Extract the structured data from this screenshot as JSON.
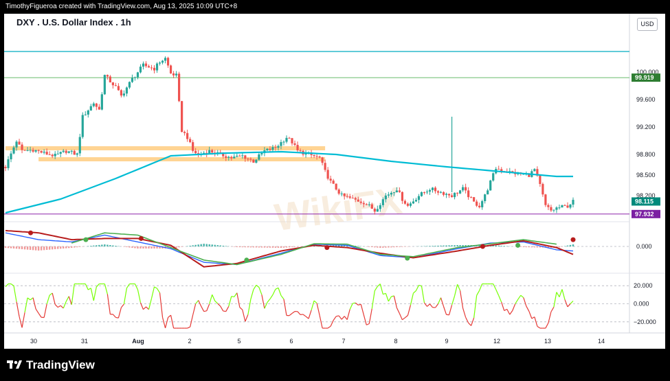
{
  "header": {
    "caption": "TimothyFigueroa created with TradingView.com, Aug 13, 2025 10:09 UTC+8",
    "symbol_title": "DXY . U.S. Dollar Index . 1h",
    "currency": "USD"
  },
  "footer": {
    "brand": "TradingView"
  },
  "watermark": {
    "text": "WikiFX"
  },
  "colors": {
    "up": "#26a69a",
    "down": "#ef5350",
    "ma": "#00bcd4",
    "zone": "#ffcc80",
    "macd_fast": "#2962ff",
    "macd_slow": "#b71c1c",
    "macd_signal": "#4caf50",
    "osc_up": "#76ff03",
    "osc_down": "#e53935",
    "price_label_green": "#2e7d32",
    "price_label_teal": "#00897b",
    "price_label_purple": "#7b1fa2"
  },
  "chart_data": {
    "type": "candlestick",
    "instrument": "DXY . U.S. Dollar Index . 1h",
    "x_ticks": [
      "30",
      "31",
      "Aug",
      "2",
      "5",
      "6",
      "7",
      "8",
      "9",
      "12",
      "13",
      "14"
    ],
    "price_axis": {
      "ticks": [
        "100.000",
        "99.600",
        "99.200",
        "98.800",
        "98.500",
        "98.200"
      ],
      "ylim": [
        97.85,
        100.45
      ]
    },
    "price_labels": [
      {
        "value": "99.919",
        "kind": "horizontal-line"
      },
      {
        "value": "98.115",
        "kind": "last-price"
      },
      {
        "value": "97.932",
        "kind": "horizontal-line"
      }
    ],
    "horizontal_lines": [
      100.3,
      99.919,
      97.932
    ],
    "support_zones": [
      {
        "from": 98.86,
        "to": 98.92,
        "label": ""
      },
      {
        "from": 98.7,
        "to": 98.76,
        "label": ""
      }
    ],
    "price_path": [
      [
        0,
        98.62
      ],
      [
        2,
        99.0
      ],
      [
        3,
        98.85
      ],
      [
        5,
        98.87
      ],
      [
        7,
        98.82
      ],
      [
        9,
        98.78
      ],
      [
        11,
        98.85
      ],
      [
        13,
        98.8
      ],
      [
        14,
        99.35
      ],
      [
        16,
        99.55
      ],
      [
        17,
        99.45
      ],
      [
        18,
        99.95
      ],
      [
        20,
        99.78
      ],
      [
        21,
        99.65
      ],
      [
        23,
        99.9
      ],
      [
        25,
        100.1
      ],
      [
        27,
        100.05
      ],
      [
        28,
        100.15
      ],
      [
        29,
        100.2
      ],
      [
        30,
        99.98
      ],
      [
        31,
        99.95
      ],
      [
        32,
        99.15
      ],
      [
        33,
        99.05
      ],
      [
        34,
        98.85
      ],
      [
        35,
        98.8
      ],
      [
        37,
        98.85
      ],
      [
        39,
        98.8
      ],
      [
        41,
        98.75
      ],
      [
        43,
        98.78
      ],
      [
        45,
        98.7
      ],
      [
        47,
        98.85
      ],
      [
        49,
        98.9
      ],
      [
        51,
        99.05
      ],
      [
        52,
        98.98
      ],
      [
        53,
        98.85
      ],
      [
        55,
        98.8
      ],
      [
        57,
        98.75
      ],
      [
        58,
        98.55
      ],
      [
        59,
        98.4
      ],
      [
        61,
        98.2
      ],
      [
        63,
        98.15
      ],
      [
        65,
        98.1
      ],
      [
        66,
        98.05
      ],
      [
        67,
        97.98
      ],
      [
        69,
        98.2
      ],
      [
        71,
        98.3
      ],
      [
        72,
        98.15
      ],
      [
        73,
        98.05
      ],
      [
        75,
        98.2
      ],
      [
        77,
        98.3
      ],
      [
        79,
        98.25
      ],
      [
        81,
        98.2
      ],
      [
        83,
        98.3
      ],
      [
        85,
        98.1
      ],
      [
        86,
        98.05
      ],
      [
        87,
        98.2
      ],
      [
        88,
        98.4
      ],
      [
        89,
        98.6
      ],
      [
        91,
        98.55
      ],
      [
        93,
        98.52
      ],
      [
        95,
        98.5
      ],
      [
        96,
        98.58
      ],
      [
        97,
        98.35
      ],
      [
        98,
        98.05
      ],
      [
        99,
        97.98
      ],
      [
        100,
        98.02
      ],
      [
        102,
        98.05
      ],
      [
        103,
        98.115
      ]
    ],
    "ma_path": [
      [
        0,
        97.95
      ],
      [
        10,
        98.15
      ],
      [
        20,
        98.45
      ],
      [
        30,
        98.78
      ],
      [
        40,
        98.82
      ],
      [
        50,
        98.84
      ],
      [
        60,
        98.8
      ],
      [
        70,
        98.7
      ],
      [
        80,
        98.62
      ],
      [
        90,
        98.55
      ],
      [
        100,
        98.48
      ]
    ],
    "spike": {
      "x": 81,
      "high": 99.35,
      "low": 98.25
    },
    "macd": {
      "zero_label": "0.000",
      "ylim": [
        -1,
        1
      ],
      "fast": [
        [
          0,
          0.6
        ],
        [
          6,
          0.3
        ],
        [
          12,
          0.2
        ],
        [
          18,
          0.5
        ],
        [
          24,
          0.2
        ],
        [
          30,
          -0.1
        ],
        [
          36,
          -0.7
        ],
        [
          42,
          -0.8
        ],
        [
          50,
          -0.3
        ],
        [
          56,
          0.1
        ],
        [
          62,
          0.05
        ],
        [
          68,
          -0.4
        ],
        [
          74,
          -0.5
        ],
        [
          82,
          -0.1
        ],
        [
          88,
          0.15
        ],
        [
          94,
          0.2
        ],
        [
          100,
          -0.15
        ],
        [
          103,
          -0.2
        ]
      ],
      "slow": [
        [
          0,
          0.7
        ],
        [
          6,
          0.6
        ],
        [
          12,
          0.3
        ],
        [
          18,
          0.35
        ],
        [
          24,
          0.35
        ],
        [
          30,
          0.05
        ],
        [
          36,
          -0.9
        ],
        [
          42,
          -0.75
        ],
        [
          50,
          -0.2
        ],
        [
          56,
          0.05
        ],
        [
          62,
          -0.05
        ],
        [
          68,
          -0.3
        ],
        [
          74,
          -0.5
        ],
        [
          82,
          -0.2
        ],
        [
          88,
          0.05
        ],
        [
          94,
          0.25
        ],
        [
          100,
          -0.05
        ],
        [
          103,
          -0.35
        ]
      ],
      "signal": [
        [
          12,
          0.15
        ],
        [
          18,
          0.6
        ],
        [
          24,
          0.5
        ],
        [
          36,
          -0.6
        ],
        [
          42,
          -0.8
        ],
        [
          50,
          -0.35
        ],
        [
          56,
          0.12
        ],
        [
          62,
          0.1
        ],
        [
          68,
          -0.35
        ],
        [
          74,
          -0.45
        ],
        [
          82,
          -0.05
        ],
        [
          88,
          0.12
        ],
        [
          94,
          0.3
        ],
        [
          100,
          0.1
        ]
      ]
    },
    "oscillator": {
      "ticks": [
        "20.000",
        "0.000",
        "−20.000"
      ],
      "ylim": [
        -30,
        30
      ]
    }
  }
}
